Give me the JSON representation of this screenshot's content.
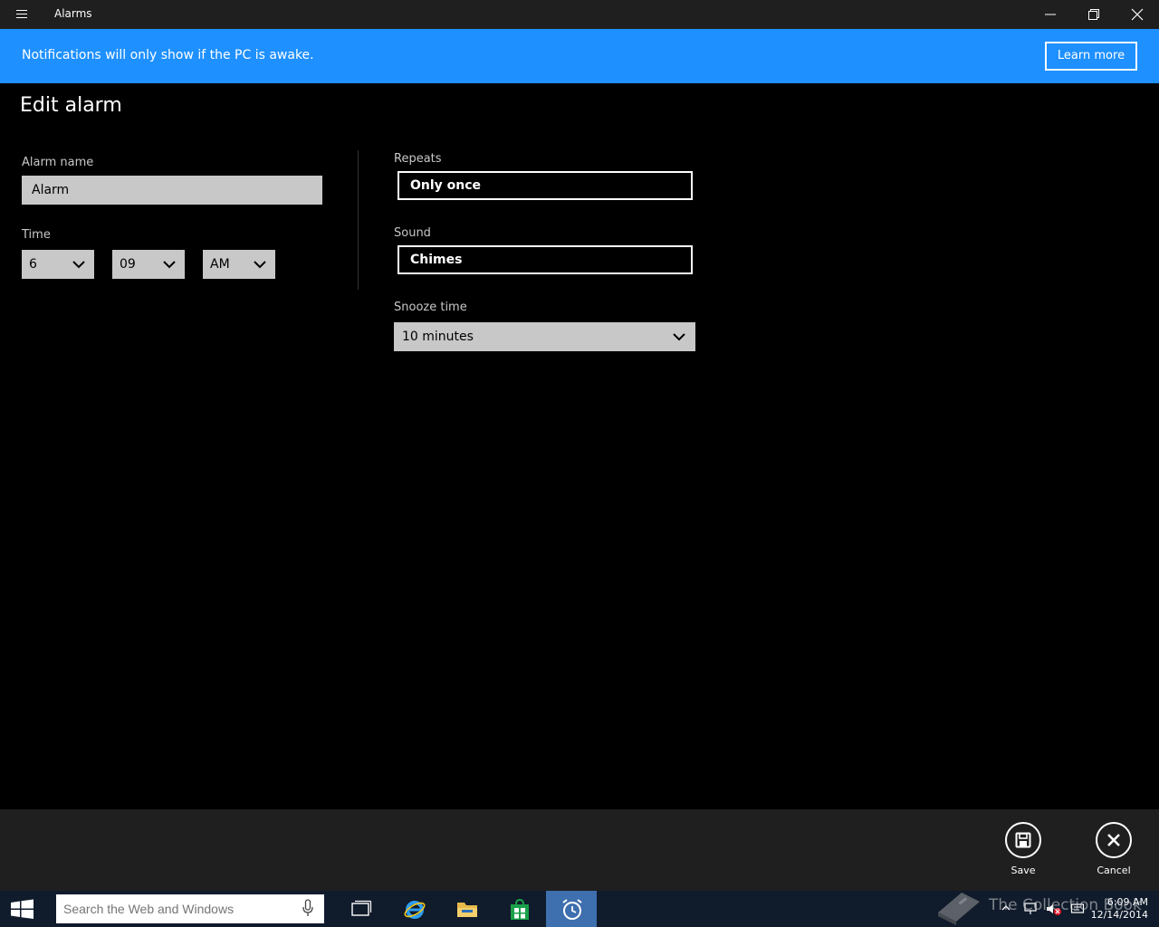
{
  "window": {
    "title": "Alarms"
  },
  "banner": {
    "text": "Notifications will only show if the PC is awake.",
    "button_label": "Learn more",
    "color": "#1e90ff"
  },
  "page": {
    "title": "Edit alarm"
  },
  "form": {
    "alarm_name": {
      "label": "Alarm name",
      "value": "Alarm"
    },
    "time": {
      "label": "Time",
      "hour": "6",
      "minute": "09",
      "period": "AM"
    },
    "repeats": {
      "label": "Repeats",
      "value": "Only once"
    },
    "sound": {
      "label": "Sound",
      "value": "Chimes"
    },
    "snooze": {
      "label": "Snooze time",
      "value": "10 minutes"
    }
  },
  "commands": {
    "save_label": "Save",
    "cancel_label": "Cancel"
  },
  "taskbar": {
    "search_placeholder": "Search the Web and Windows",
    "clock_time": "6:09 AM",
    "clock_date": "12/14/2014",
    "active_app": "alarms-clock-icon"
  },
  "watermark": {
    "text": "The Collection Book"
  }
}
